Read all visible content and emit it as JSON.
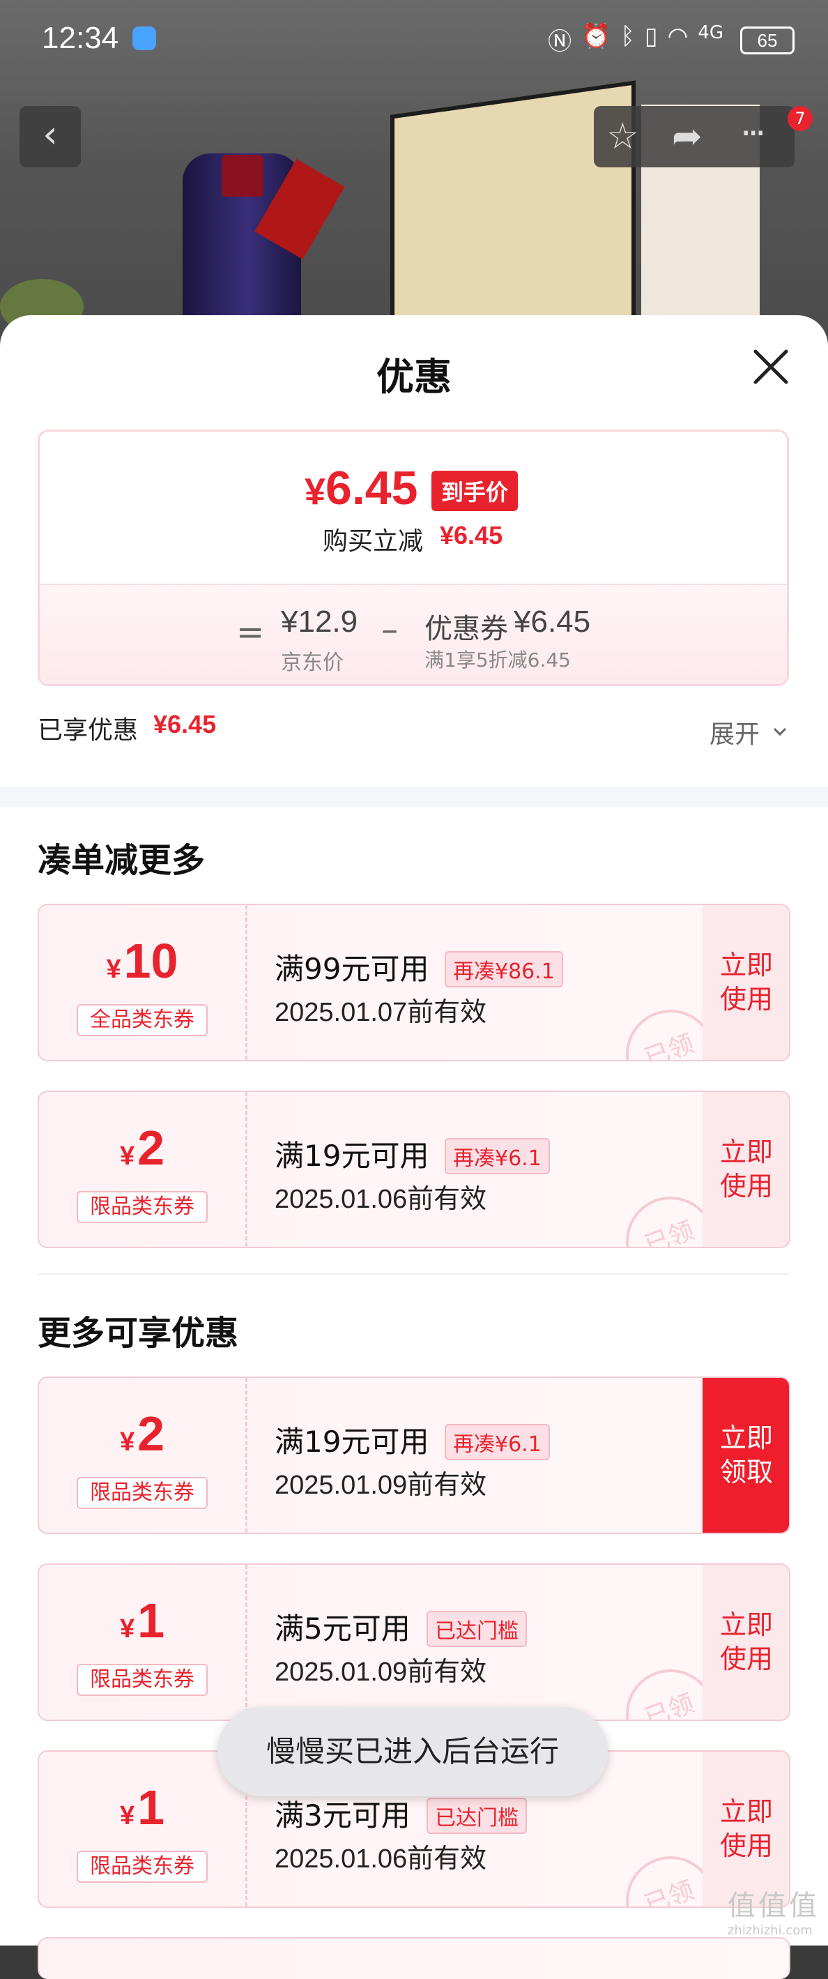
{
  "status_bar": {
    "time": "12:34",
    "icons": [
      "nfc-icon",
      "alarm-icon",
      "bluetooth-icon",
      "vibrate-icon",
      "wifi-icon",
      "4g-signal-icon"
    ],
    "network": "4G",
    "battery": "65"
  },
  "nav": {
    "badge": "7"
  },
  "sheet": {
    "title": "优惠",
    "final_price": "6.45",
    "currency": "¥",
    "final_tag": "到手价",
    "instant_label": "购买立减",
    "instant_value": "¥6.45",
    "equation": {
      "eq": "=",
      "jd_price": "¥12.9",
      "jd_label": "京东价",
      "minus": "–",
      "coupon_name": "优惠券",
      "coupon_amount": "¥6.45",
      "coupon_rule": "满1享5折减6.45"
    },
    "enjoyed_label": "已享优惠",
    "enjoyed_value": "¥6.45",
    "expand_label": "展开"
  },
  "sections": {
    "combine": "凑单减更多",
    "more": "更多可享优惠"
  },
  "coupons": [
    {
      "amount": "10",
      "type": "全品类东券",
      "condition": "满99元可用",
      "gap": "再凑¥86.1",
      "date": "2025.01.07前有效",
      "action": "立即\n使用",
      "stamp": "已领"
    },
    {
      "amount": "2",
      "type": "限品类东券",
      "condition": "满19元可用",
      "gap": "再凑¥6.1",
      "date": "2025.01.06前有效",
      "action": "立即\n使用",
      "stamp": "已领"
    },
    {
      "amount": "2",
      "type": "限品类东券",
      "condition": "满19元可用",
      "gap": "再凑¥6.1",
      "date": "2025.01.09前有效",
      "action": "立即\n领取",
      "stamp": ""
    },
    {
      "amount": "1",
      "type": "限品类东券",
      "condition": "满5元可用",
      "gap": "已达门槛",
      "date": "2025.01.09前有效",
      "action": "立即\n使用",
      "stamp": "已领"
    },
    {
      "amount": "1",
      "type": "限品类东券",
      "condition": "满3元可用",
      "gap": "已达门槛",
      "date": "2025.01.06前有效",
      "action": "立即\n使用",
      "stamp": "已领"
    }
  ],
  "toast": "慢慢买已进入后台运行",
  "watermark": {
    "text": "值值值",
    "url": "zhizhizhi.com"
  },
  "colors": {
    "accent": "#e8232e",
    "coupon_bg": "#fff2f4",
    "primary_action": "#ee1e2c"
  }
}
